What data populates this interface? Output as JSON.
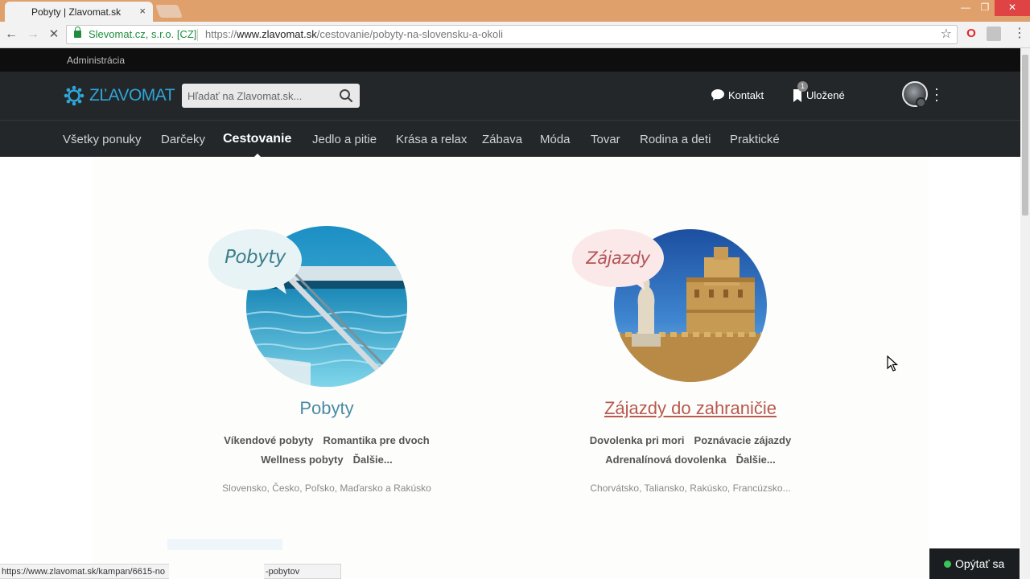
{
  "browser": {
    "tab_title": "Pobyty | Zlavomat.sk",
    "tab_close": "×",
    "window_min": "—",
    "window_max": "❐",
    "window_close": "✕",
    "back": "←",
    "forward": "→",
    "stop": "✕",
    "origin": "Slevomat.cz, s.r.o. [CZ]",
    "url_prefix": "https://",
    "url_host": "www.zlavomat.sk",
    "url_path": "/cestovanie/pobyty-na-slovensku-a-okoli",
    "star": "☆",
    "ext_opera": "O",
    "menu": "⋮",
    "status_url": "https://www.zlavomat.sk/kampan/6615-no",
    "status_url_tail": "-pobytov"
  },
  "site": {
    "admin_link": "Administrácia",
    "logo_text": "ZĽAVOMAT",
    "search_placeholder": "Hľadať na Zlavomat.sk...",
    "kontakt": "Kontakt",
    "ulozene": "Uložené",
    "saved_count": "1",
    "brand_color": "#2fa6d8"
  },
  "categories": [
    {
      "label": "Všetky ponuky"
    },
    {
      "label": "Darčeky"
    },
    {
      "label": "Cestovanie"
    },
    {
      "label": "Jedlo a pitie"
    },
    {
      "label": "Krása a relax"
    },
    {
      "label": "Zábava"
    },
    {
      "label": "Móda"
    },
    {
      "label": "Tovar"
    },
    {
      "label": "Rodina a deti"
    },
    {
      "label": "Praktické"
    }
  ],
  "cards": {
    "pobyty": {
      "bubble": "Pobyty",
      "title": "Pobyty",
      "links_row1": [
        "Víkendové pobyty",
        "Romantika pre dvoch"
      ],
      "links_row2": [
        "Wellness pobyty",
        "Ďalšie..."
      ],
      "countries": "Slovensko, Česko, Poľsko, Maďarsko a Rakúsko"
    },
    "zajazdy": {
      "bubble": "Zájazdy",
      "title": "Zájazdy do zahraničie",
      "links_row1": [
        "Dovolenka pri mori",
        "Poznávacie zájazdy"
      ],
      "links_row2": [
        "Adrenalínová dovolenka",
        "Ďalšie..."
      ],
      "countries": "Chorvátsko, Taliansko, Rakúsko, Francúzsko..."
    }
  },
  "chat": {
    "label": "Opýtať sa",
    "status_color": "#3cc556"
  }
}
